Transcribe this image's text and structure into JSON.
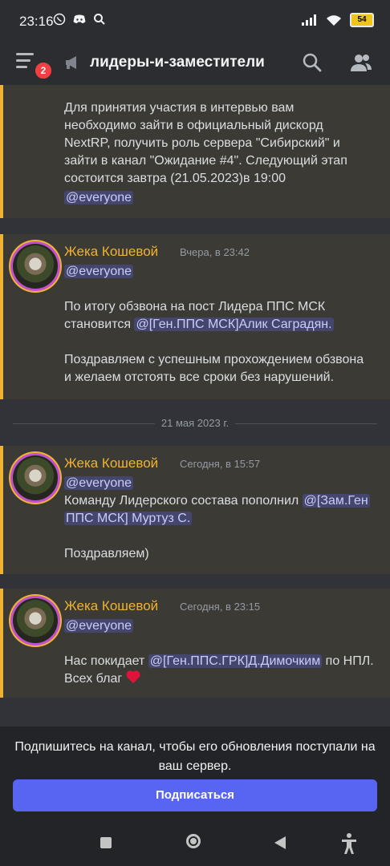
{
  "status_bar": {
    "time": "23:16",
    "battery": "54"
  },
  "header": {
    "channel_name": "лидеры-и-заместители",
    "unread_badge": "2"
  },
  "messages": [
    {
      "lines": [
        "Для принятия участия в интервью вам",
        "необходимо зайти в официальный дискорд",
        "NextRP, получить роль сервера \"Сибирский\" и",
        "зайти в канал \"Ожидание #4\". Следующий этап",
        "состоится завтра (21.05.2023)в 19:00"
      ],
      "mention": "@everyone"
    },
    {
      "author": "Жека Кошевой",
      "timestamp": "Вчера, в 23:42",
      "mention": "@everyone",
      "line1": "По итогу обзвона на пост Лидера ППС МСК",
      "line2_prefix": "становится ",
      "line2_mention": "@[Ген.ППС МСК]Алик Саградян.",
      "line3": "Поздравляем с успешным прохождением обзвона",
      "line4": "и желаем отстоять все сроки без нарушений."
    },
    {
      "author": "Жека Кошевой",
      "timestamp": "Сегодня, в 15:57",
      "mention": "@everyone",
      "line1_prefix": "Команду Лидерского состава пополнил ",
      "line1_mention": "@[Зам.Ген",
      "line2_mention": "ППС МСК] Муртуз С.",
      "line3": "Поздравляем)"
    },
    {
      "author": "Жека Кошевой",
      "timestamp": "Сегодня, в 23:15",
      "mention": "@everyone",
      "line1_prefix": "Нас покидает ",
      "line1_mention": "@[Ген.ППС.ГРК]Д.Димочким",
      "line1_suffix": " по НПЛ.",
      "line2": "Всех благ "
    }
  ],
  "date_divider": "21 мая 2023 г.",
  "footer": {
    "text": "Подпишитесь на канал, чтобы его обновления поступали на ваш сервер.",
    "button": "Подписаться"
  },
  "colors": {
    "accent": "#5865f2",
    "author": "#f0b232",
    "highlight": "#3b3a35",
    "badge": "#f23f43"
  }
}
